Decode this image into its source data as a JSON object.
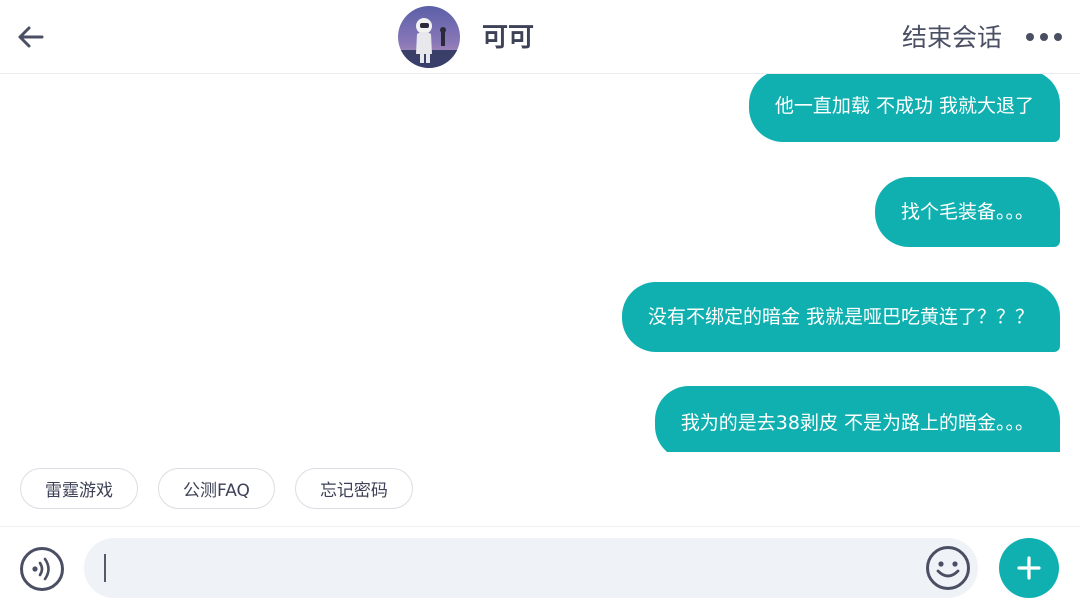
{
  "header": {
    "back_icon": "arrow-left-icon",
    "contact_name": "可可",
    "end_session_label": "结束会话",
    "more_icon": "more-horizontal-icon"
  },
  "messages": [
    {
      "sender": "me",
      "text": "他一直加载 不成功 我就大退了"
    },
    {
      "sender": "me",
      "text": "找个毛装备。。。"
    },
    {
      "sender": "me",
      "text": "没有不绑定的暗金 我就是哑巴吃黄连了？？？"
    },
    {
      "sender": "me",
      "text": "我为的是去38剥皮 不是为路上的暗金。。。"
    }
  ],
  "quick_replies": [
    "雷霆游戏",
    "公测FAQ",
    "忘记密码"
  ],
  "input": {
    "placeholder": "",
    "value": "",
    "voice_icon": "voice-icon",
    "emoji_icon": "smiley-icon",
    "plus_icon": "plus-icon"
  },
  "colors": {
    "accent": "#10b0b0",
    "text_primary": "#3e4257",
    "input_bg": "#eff2f6"
  }
}
